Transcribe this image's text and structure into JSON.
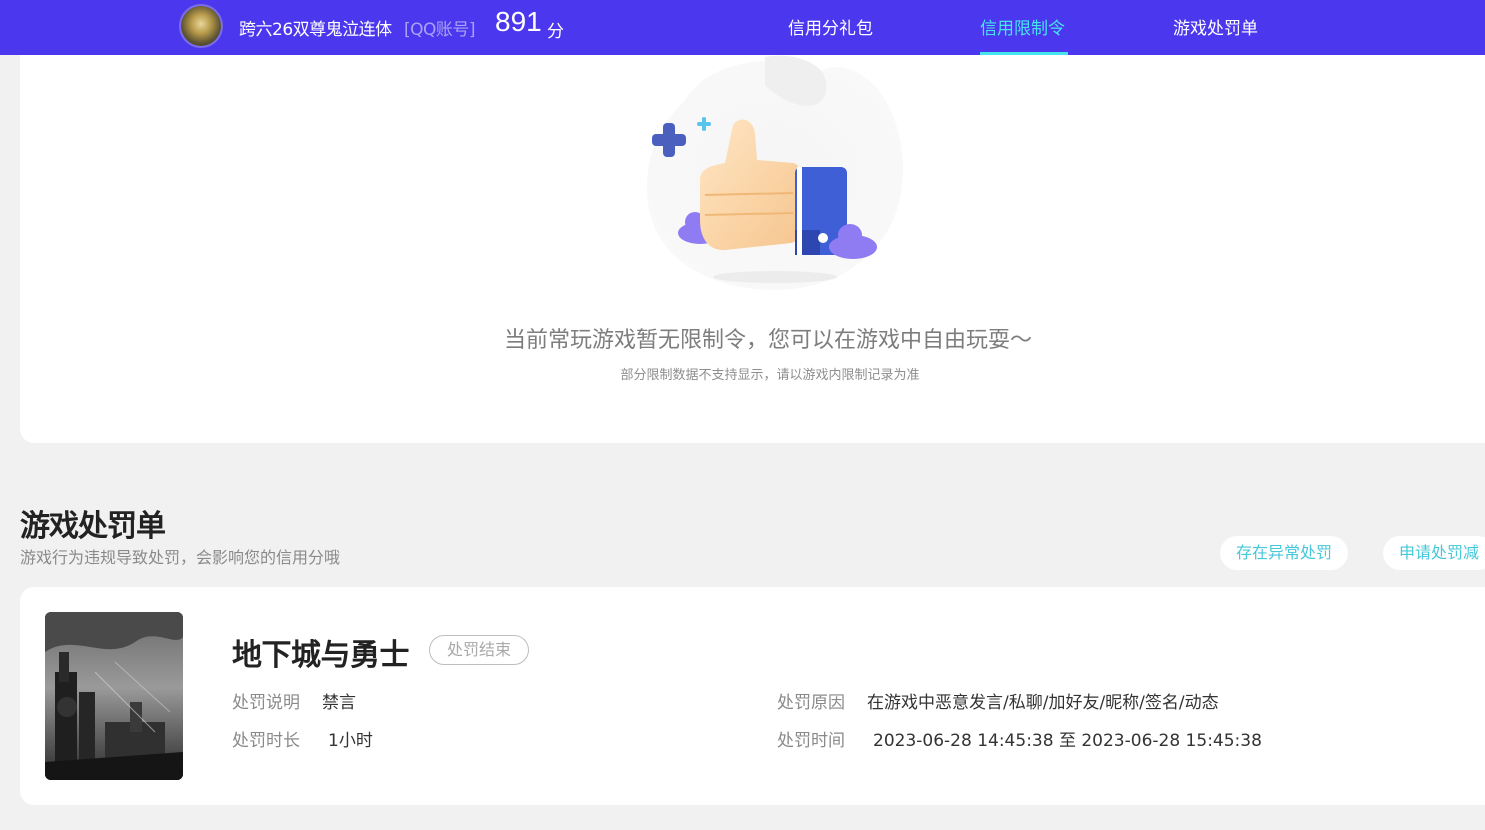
{
  "header": {
    "user_name": "跨六26双尊鬼泣连体",
    "account_type": "[QQ账号]",
    "score": "891",
    "score_unit": "分",
    "nav": [
      "信用分礼包",
      "信用限制令",
      "游戏处罚单"
    ],
    "active_nav": "信用限制令",
    "accent_color": "#45e5f0",
    "bar_color": "#4b38ee"
  },
  "restriction": {
    "empty_title": "当前常玩游戏暂无限制令，您可以在游戏中自由玩耍～",
    "empty_note": "部分限制数据不支持显示，请以游戏内限制记录为准"
  },
  "penalty_section": {
    "title": "游戏处罚单",
    "subtitle": "游戏行为违规导致处罚，会影响您的信用分哦",
    "buttons": [
      "存在异常处罚",
      "申请处罚减"
    ]
  },
  "penalty_card": {
    "game_name": "地下城与勇士",
    "status": "处罚结束",
    "fields": {
      "desc_label": "处罚说明",
      "desc_value": "禁言",
      "duration_label": "处罚时长",
      "duration_value": "1小时",
      "reason_label": "处罚原因",
      "reason_value": "在游戏中恶意发言/私聊/加好友/昵称/签名/动态",
      "time_label": "处罚时间",
      "time_value": "2023-06-28 14:45:38 至 2023-06-28 15:45:38"
    }
  }
}
